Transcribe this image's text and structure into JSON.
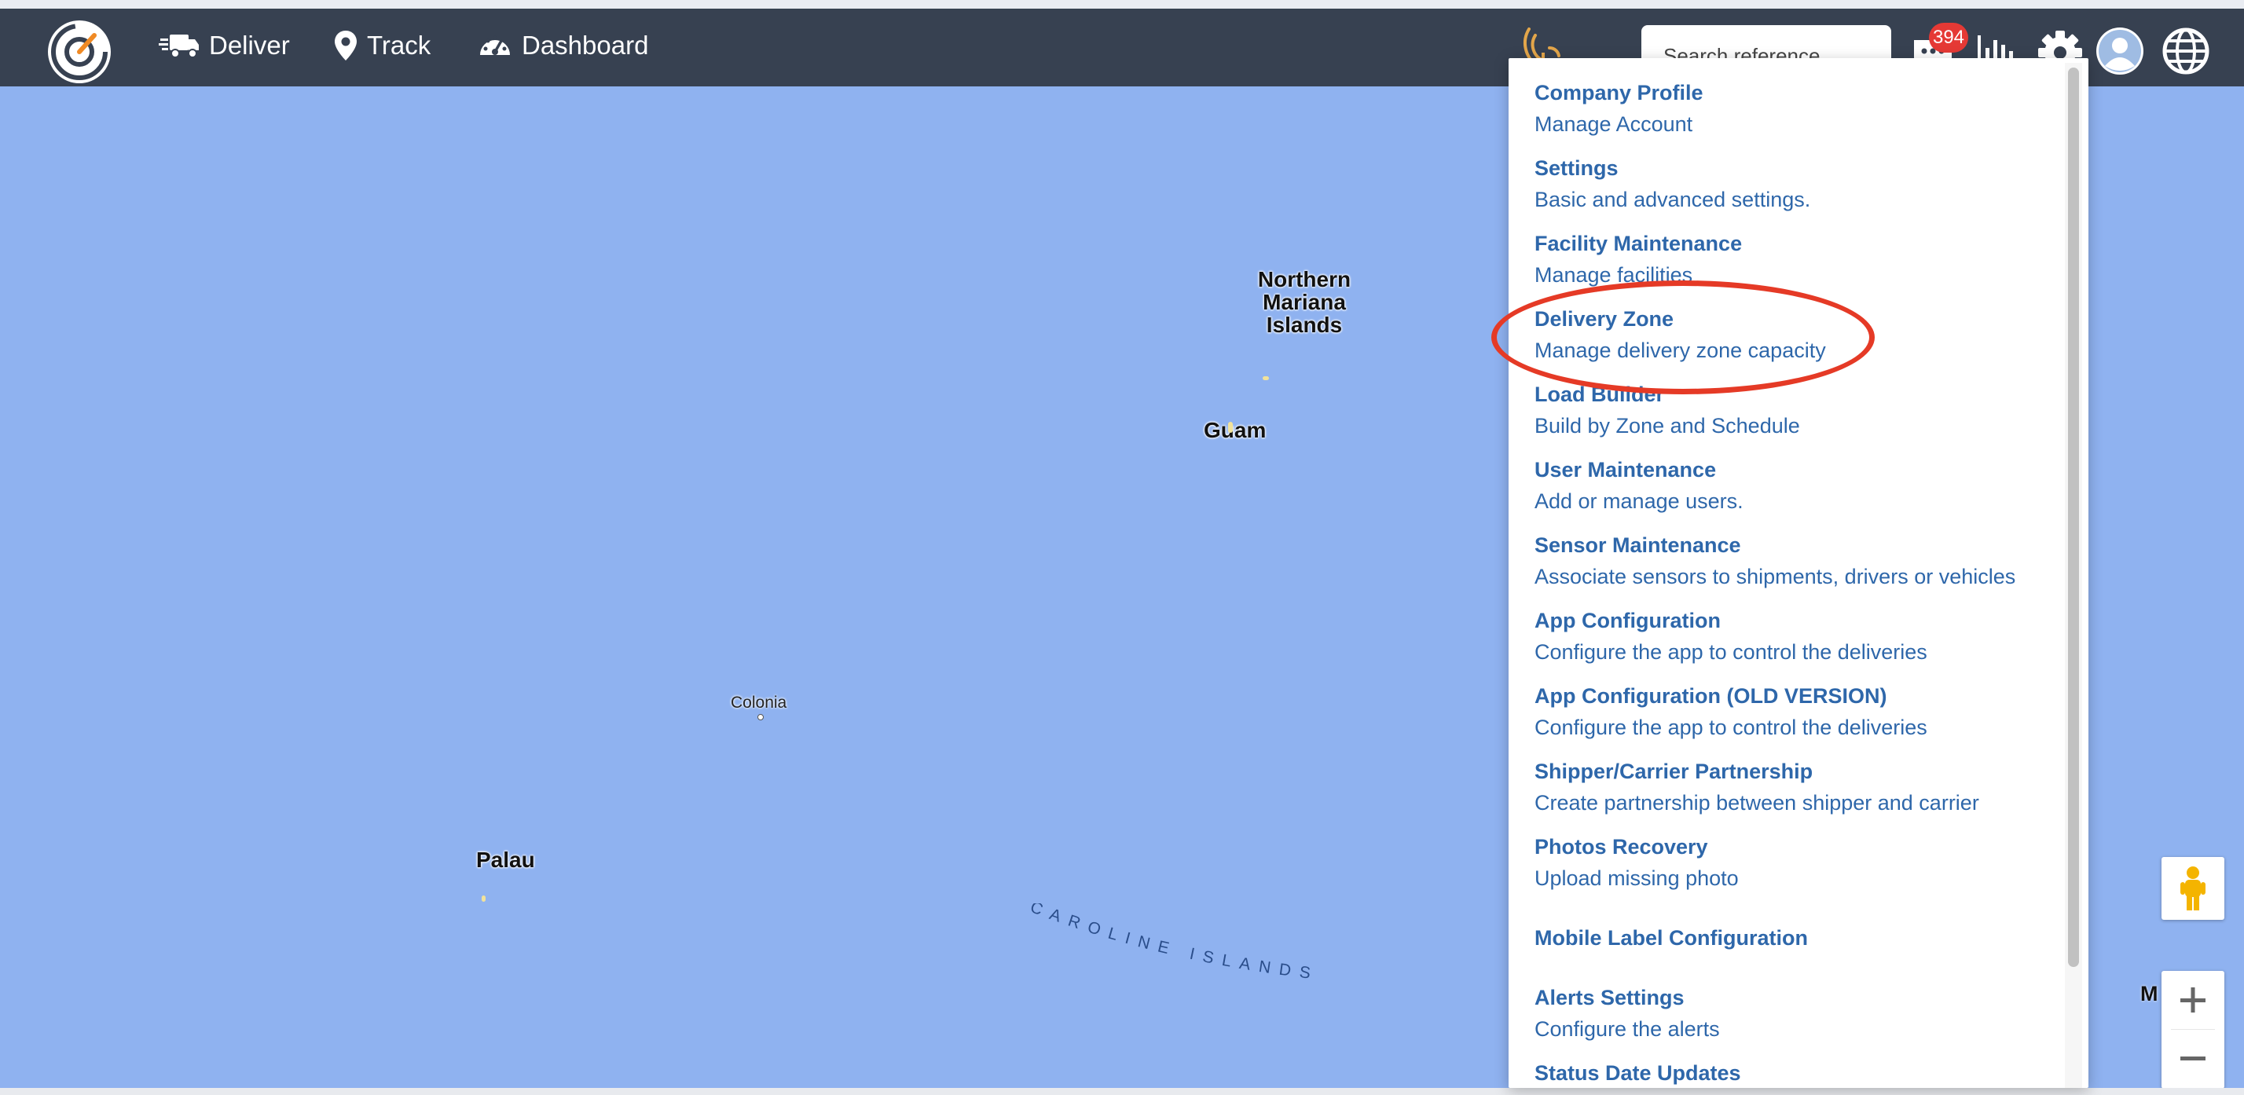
{
  "nav": {
    "items": [
      {
        "label": "Deliver",
        "icon": "truck-icon"
      },
      {
        "label": "Track",
        "icon": "map-pin-icon"
      },
      {
        "label": "Dashboard",
        "icon": "dashboard-gauge-icon"
      }
    ],
    "search_placeholder": "Search reference",
    "notifications_count": "394"
  },
  "map": {
    "labels": {
      "northern_mariana": [
        "Northern",
        "Mariana",
        "Islands"
      ],
      "guam": "Guam",
      "colonia": "Colonia",
      "palau": "Palau",
      "caroline": "CAROLINE ISLANDS",
      "edge": "M        es"
    },
    "colors": {
      "water": "#8fb2f0",
      "land": "#f1e29b"
    }
  },
  "menu": {
    "items": [
      {
        "title": "Company Profile",
        "desc": "Manage Account"
      },
      {
        "title": "Settings",
        "desc": "Basic and advanced settings."
      },
      {
        "title": "Facility Maintenance",
        "desc": "Manage facilities"
      },
      {
        "title": "Delivery Zone",
        "desc": "Manage delivery zone capacity"
      },
      {
        "title": "Load Builder",
        "desc": "Build by Zone and Schedule"
      },
      {
        "title": "User Maintenance",
        "desc": "Add or manage users."
      },
      {
        "title": "Sensor Maintenance",
        "desc": "Associate sensors to shipments, drivers or vehicles"
      },
      {
        "title": "App Configuration",
        "desc": "Configure the app to control the deliveries"
      },
      {
        "title": "App Configuration (OLD VERSION)",
        "desc": "Configure the app to control the deliveries"
      },
      {
        "title": "Shipper/Carrier Partnership",
        "desc": "Create partnership between shipper and carrier"
      },
      {
        "title": "Photos Recovery",
        "desc": "Upload missing photo"
      },
      {
        "title": "Mobile Label Configuration",
        "desc": ""
      },
      {
        "title": "Alerts Settings",
        "desc": "Configure the alerts"
      },
      {
        "title": "Status Date Updates",
        "desc": ""
      }
    ],
    "highlighted": "Delivery Zone",
    "accent_color": "#2e67aa",
    "annotation_color": "#e53a26"
  }
}
